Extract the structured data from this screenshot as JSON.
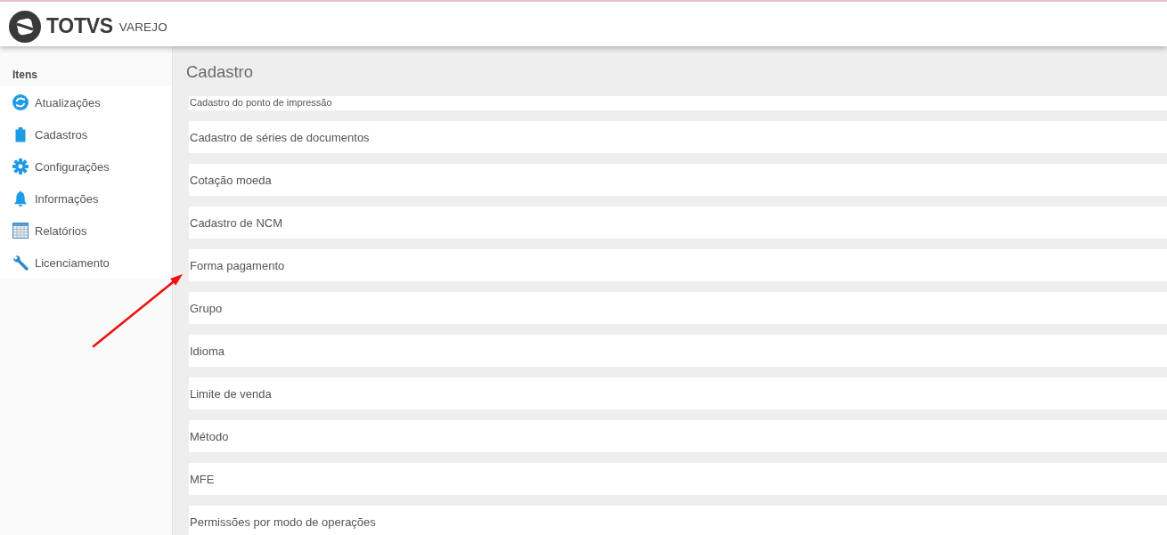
{
  "header": {
    "brand": "TOTVS",
    "product": "VAREJO"
  },
  "sidebar": {
    "heading": "Itens",
    "items": [
      {
        "label": "Atualizações",
        "kind": "refresh"
      },
      {
        "label": "Cadastros",
        "kind": "clipboard"
      },
      {
        "label": "Configurações",
        "kind": "gear"
      },
      {
        "label": "Informações",
        "kind": "bell"
      },
      {
        "label": "Relatórios",
        "kind": "table"
      },
      {
        "label": "Licenciamento",
        "kind": "wrench"
      }
    ]
  },
  "content": {
    "title": "Cadastro",
    "items": [
      "Cadastro do ponto de impressão",
      "Cadastro de séries de documentos",
      "Cotação moeda",
      "Cadastro de NCM",
      "Forma pagamento",
      "Grupo",
      "Idioma",
      "Limite de venda",
      "Método",
      "MFE",
      "Permissões por modo de operações"
    ]
  }
}
